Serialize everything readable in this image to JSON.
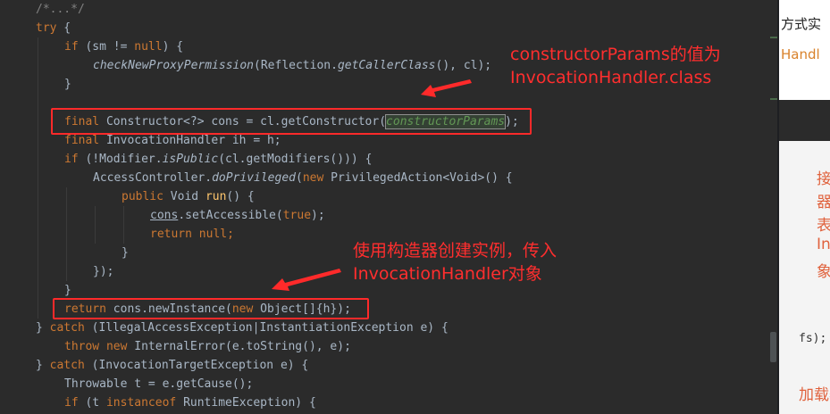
{
  "code": {
    "l0": "/*...*/",
    "l1_try": "try",
    "l2_if": "if",
    "l2_rest": " (sm != ",
    "l2_null": "null",
    "l2_end": ") {",
    "l3_fn": "checkNewProxyPermission",
    "l3_a": "(Reflection.",
    "l3_fn2": "getCallerClass",
    "l3_b": "(), cl);",
    "l4": "}",
    "l6_final": "final",
    "l6_a": " Constructor<?> cons = cl.getConstructor(",
    "l6_param": "constructorParams",
    "l6_b": ");",
    "l7_final": "final",
    "l7_a": " InvocationHandler ih = h;",
    "l8_if": "if",
    "l8_a": " (!Modifier.",
    "l8_fn": "isPublic",
    "l8_b": "(cl.getModifiers())) {",
    "l9_a": "AccessController.",
    "l9_fn": "doPrivileged",
    "l9_b": "(",
    "l9_new": "new",
    "l9_c": " PrivilegedAction<Void>() {",
    "l10_pub": "public",
    "l10_a": " Void ",
    "l10_fn": "run",
    "l10_b": "() {",
    "l11_cons": "cons",
    "l11_a": ".setAccessible(",
    "l11_true": "true",
    "l11_b": ");",
    "l12_ret": "return",
    "l12_null": "null",
    "l12_semi": ";",
    "l13": "}",
    "l14": "});",
    "l15": "}",
    "l16_ret": "return",
    "l16_a": " cons.newInstance(",
    "l16_new": "new",
    "l16_b": " Object[]{h});",
    "l17_a": "} ",
    "l17_catch": "catch",
    "l17_b": " (IllegalAccessException|InstantiationException e) {",
    "l18_throw": "throw",
    "l18_new": "new",
    "l18_a": " InternalError(e.toString(), e);",
    "l19_a": "} ",
    "l19_catch": "catch",
    "l19_b": " (InvocationTargetException e) {",
    "l20_a": "Throwable t = e.getCause();",
    "l21_if": "if",
    "l21_a": " (t ",
    "l21_inst": "instanceof",
    "l21_b": " RuntimeException) {"
  },
  "annotations": {
    "note1_line1": "constructorParams的值为",
    "note1_line2": "InvocationHandler.class",
    "note2_line1": "使用构造器创建实例，传入",
    "note2_line2": "InvocationHandler对象"
  },
  "right_panel": {
    "t1": "方式实",
    "t2": "Handl",
    "t3": "接",
    "t4": "器",
    "t5": "表",
    "t6": "In",
    "t7": "象",
    "t8": "fs);",
    "t9": "加载器"
  },
  "colors": {
    "editor_bg": "#2b2b2b",
    "keyword": "#cc7832",
    "method": "#ffc66d",
    "annotation_red": "#ff2a2a"
  }
}
